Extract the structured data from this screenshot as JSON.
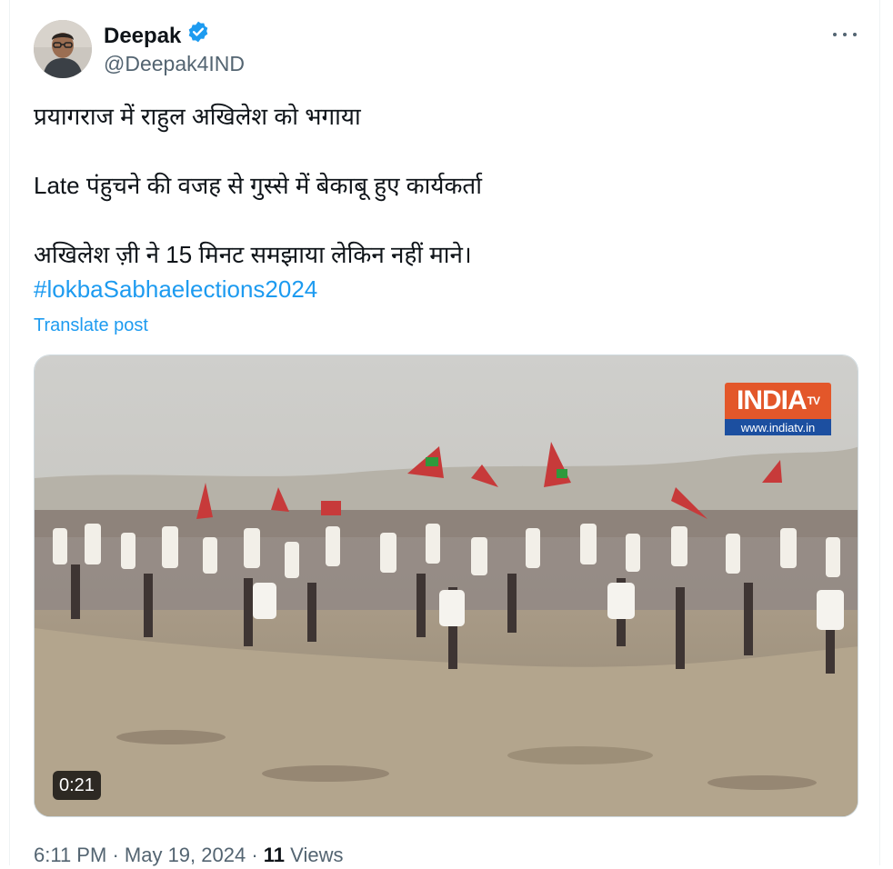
{
  "author": {
    "name": "Deepak",
    "handle": "@Deepak4IND",
    "verified": true
  },
  "post": {
    "line1": "प्रयागराज में राहुल अखिलेश को भगाया",
    "line2": "Late पंहुचने की वजह से गुस्से में बेकाबू हुए कार्यकर्ता",
    "line3": "अखिलेश ज़ी ने 15 मिनट समझाया लेकिन नहीं माने।",
    "hashtag": "#lokbaSabhaelections2024",
    "translate_label": "Translate post"
  },
  "video": {
    "duration": "0:21",
    "logo_main": "INDIA",
    "logo_sup": "TV",
    "logo_url": "www.indiatv.in"
  },
  "meta": {
    "time": "6:11 PM",
    "separator": "·",
    "date": "May 19, 2024",
    "views_count": "11",
    "views_label": "Views"
  },
  "colors": {
    "accent": "#1d9bf0",
    "secondary_text": "#536471",
    "logo_orange": "#e3572a",
    "logo_blue": "#1c4fa0"
  },
  "icons": {
    "verified": "verified-badge-icon",
    "more": "more-options-icon"
  }
}
